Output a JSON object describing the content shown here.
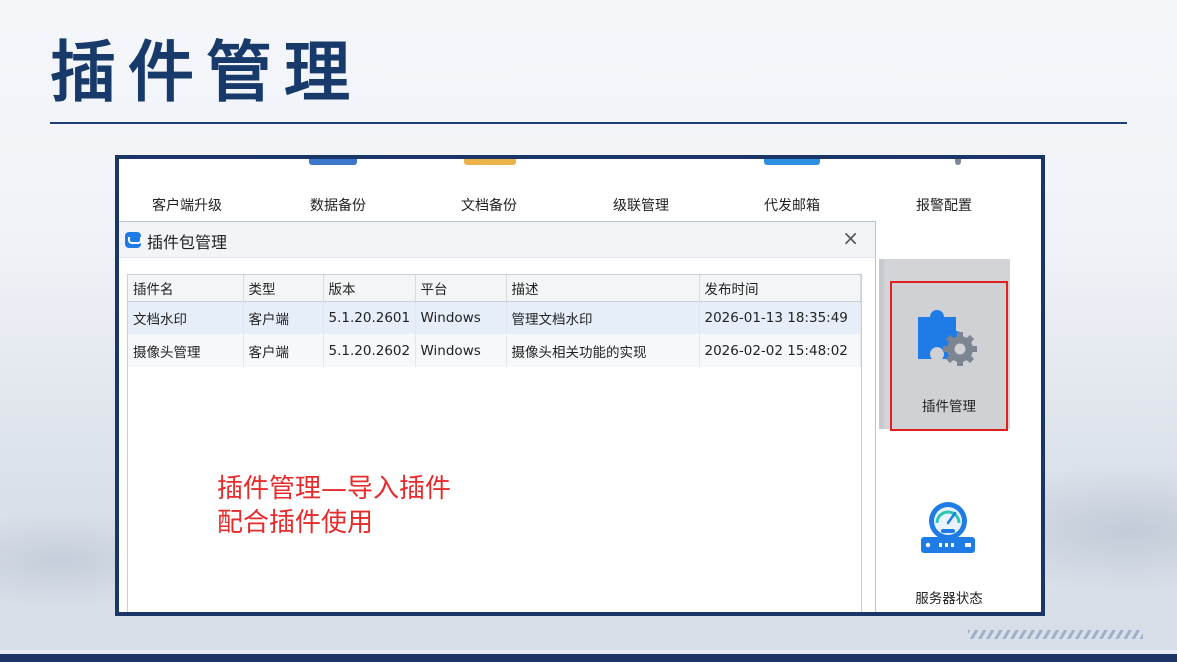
{
  "slide": {
    "title": "插件管理",
    "note_line1": "插件管理—导入插件",
    "note_line2": "配合插件使用"
  },
  "app": {
    "top_tabs": [
      "客户端升级",
      "数据备份",
      "文档备份",
      "级联管理",
      "代发邮箱",
      "报警配置"
    ]
  },
  "dialog": {
    "title": "插件包管理",
    "close_glyph": "×",
    "columns": [
      "插件名",
      "类型",
      "版本",
      "平台",
      "描述",
      "发布时间"
    ],
    "rows": [
      [
        "文档水印",
        "客户端",
        "5.1.20.2601",
        "Windows",
        "管理文档水印",
        "2026-01-13 18:35:49"
      ],
      [
        "摄像头管理",
        "客户端",
        "5.1.20.2602",
        "Windows",
        "摄像头相关功能的实现",
        "2026-02-02 15:48:02"
      ]
    ]
  },
  "side_panel": {
    "plugin_label": "插件管理",
    "server_label": "服务器状态",
    "plugin_icon": "puzzle-gear-icon",
    "server_icon": "server-gauge-icon"
  },
  "colors": {
    "title_navy": "#173a6b",
    "frame_navy": "#1b3566",
    "note_red": "#e52b2b",
    "highlight_red": "#e11f1f",
    "icon_blue": "#1f7be5"
  }
}
